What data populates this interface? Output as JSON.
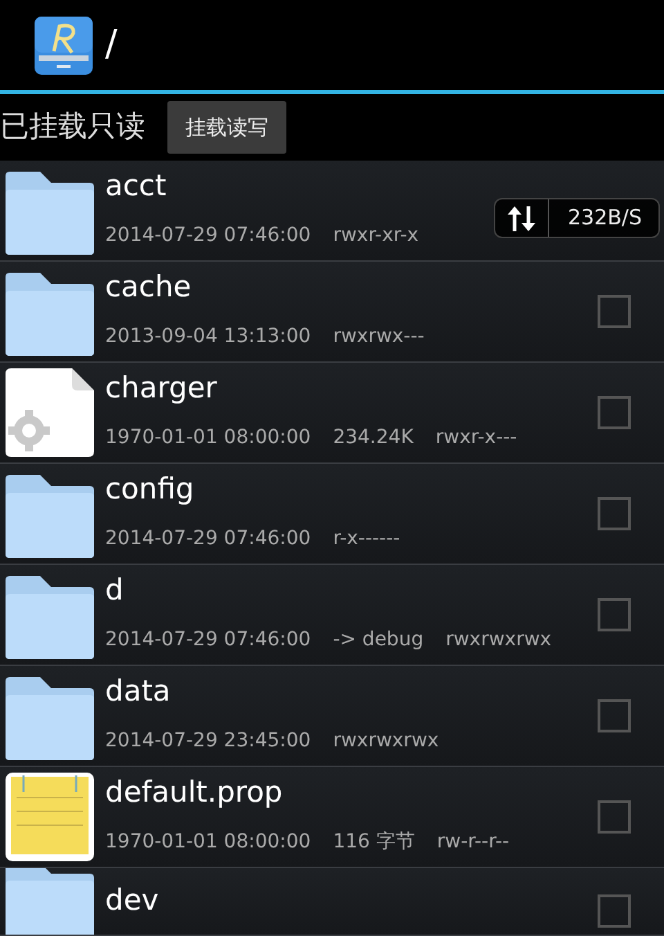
{
  "app_bar": {
    "path": "/"
  },
  "mount_bar": {
    "status": "已挂载只读",
    "button": "挂载读写"
  },
  "files": [
    {
      "kind": "folder",
      "name": "acct",
      "date": "2014-07-29 07:46:00",
      "perms": "rwxr-xr-x"
    },
    {
      "kind": "folder",
      "name": "cache",
      "date": "2013-09-04 13:13:00",
      "perms": "rwxrwx---",
      "checked": false
    },
    {
      "kind": "gear",
      "name": "charger",
      "date": "1970-01-01 08:00:00",
      "info": "234.24K",
      "perms": "rwxr-x---",
      "checked": false
    },
    {
      "kind": "folder",
      "name": "config",
      "date": "2014-07-29 07:46:00",
      "perms": "r-x------",
      "checked": false
    },
    {
      "kind": "folder",
      "name": "d",
      "date": "2014-07-29 07:46:00",
      "info": "-> debug",
      "perms": "rwxrwxrwx",
      "checked": false
    },
    {
      "kind": "folder",
      "name": "data",
      "date": "2014-07-29 23:45:00",
      "perms": "rwxrwxrwx",
      "checked": false
    },
    {
      "kind": "note",
      "name": "default.prop",
      "date": "1970-01-01 08:00:00",
      "info": "116 字节",
      "perms": "rw-r--r--",
      "checked": false
    },
    {
      "kind": "folder",
      "name": "dev",
      "checked": false
    }
  ],
  "speed_widget": {
    "reading": "232B/S"
  }
}
